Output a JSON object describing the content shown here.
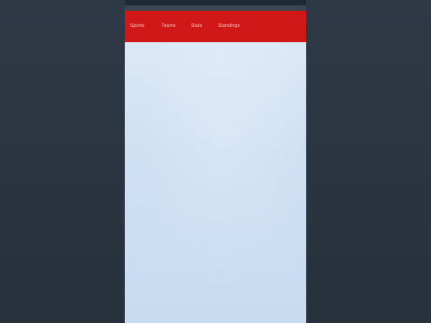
{
  "nav": {
    "items": [
      {
        "label": "Sports"
      },
      {
        "label": "Teams"
      },
      {
        "label": "Stats"
      },
      {
        "label": "Standings"
      }
    ]
  },
  "colors": {
    "nav_background": "#d01818",
    "page_background": "#cfe0f3",
    "surround": "#2a3440"
  }
}
